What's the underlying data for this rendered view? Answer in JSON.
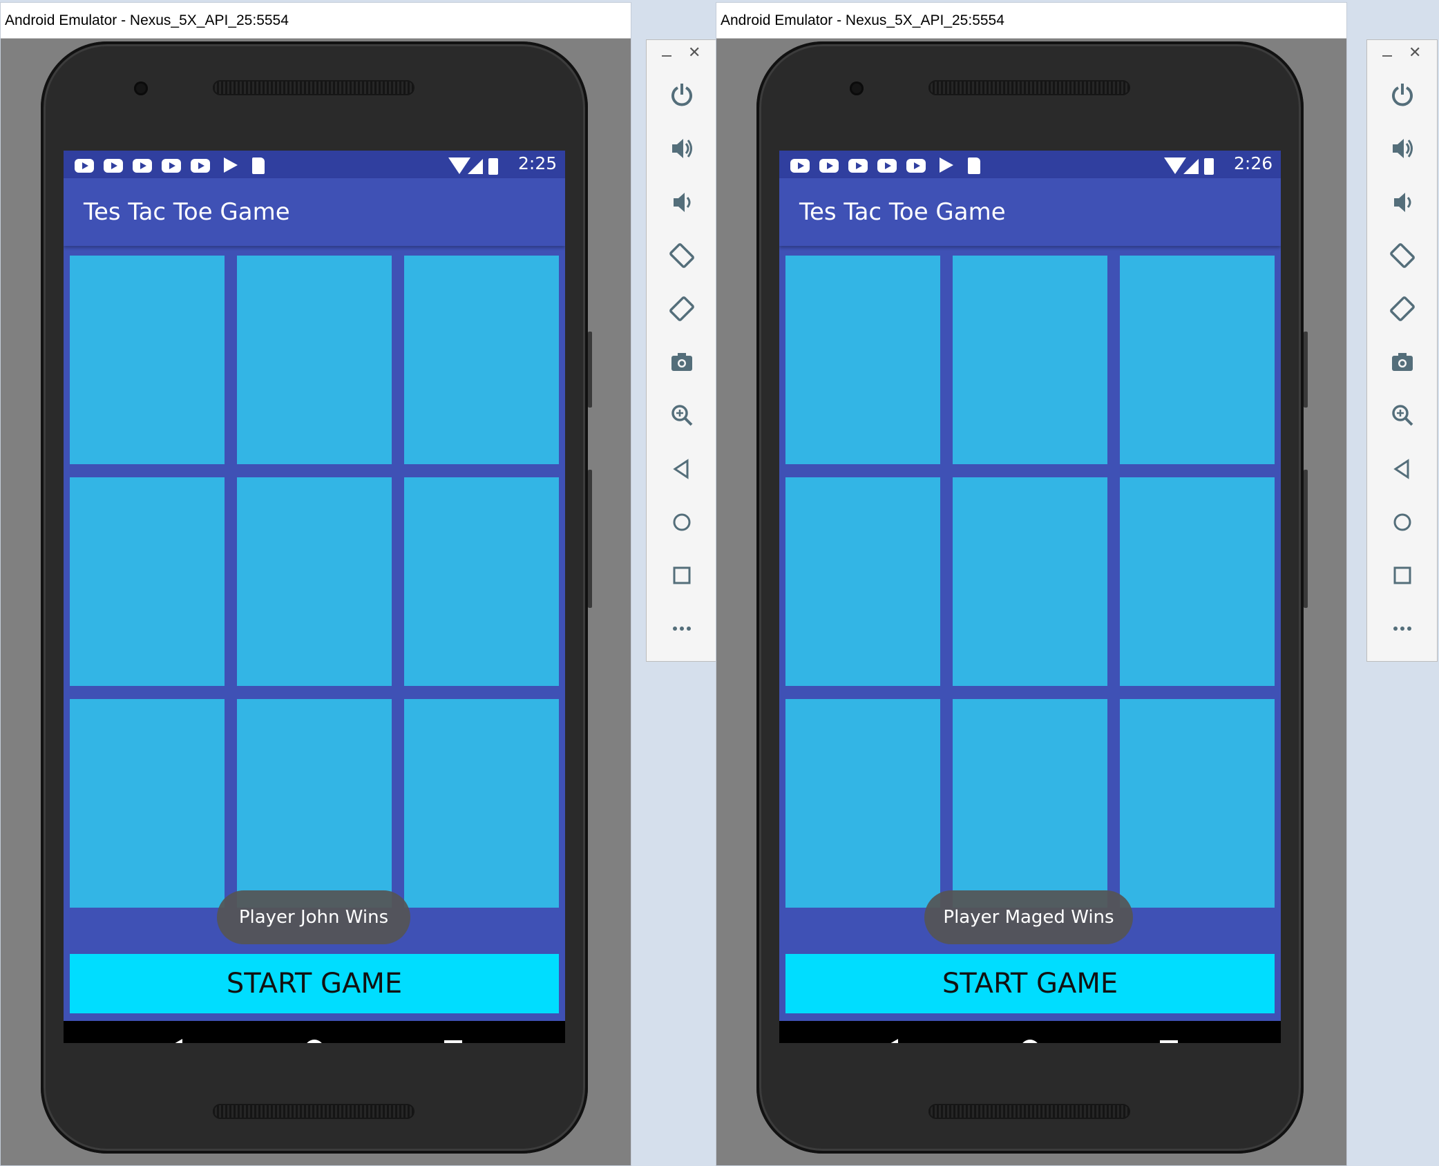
{
  "desktop": {
    "windows": [
      {
        "title": "Android Emulator - Nexus_5X_API_25:5554",
        "statusbar": {
          "time": "2:25"
        },
        "app": {
          "title": "Tes Tac Toe Game",
          "cells": [
            "",
            "",
            "",
            "",
            "",
            "",
            "",
            "",
            ""
          ],
          "start_label": "START GAME",
          "toast": "Player John Wins"
        }
      },
      {
        "title": "Android Emulator - Nexus_5X_API_25:5554",
        "statusbar": {
          "time": "2:26"
        },
        "app": {
          "title": "Tes Tac Toe Game",
          "cells": [
            "",
            "",
            "",
            "",
            "",
            "",
            "",
            "",
            ""
          ],
          "start_label": "START GAME",
          "toast": "Player Maged Wins"
        }
      }
    ]
  },
  "toolbar": {
    "buttons": [
      "power-icon",
      "volume-up-icon",
      "volume-down-icon",
      "rotate-left-icon",
      "rotate-right-icon",
      "camera-icon",
      "zoom-icon",
      "back-icon",
      "home-icon",
      "overview-icon",
      "more-icon"
    ]
  },
  "colors": {
    "primary": "#3f51b5",
    "primary_dark": "#303f9f",
    "cell": "#33b5e5",
    "button": "#00ddff",
    "toolbar_icon": "#546e7a"
  }
}
